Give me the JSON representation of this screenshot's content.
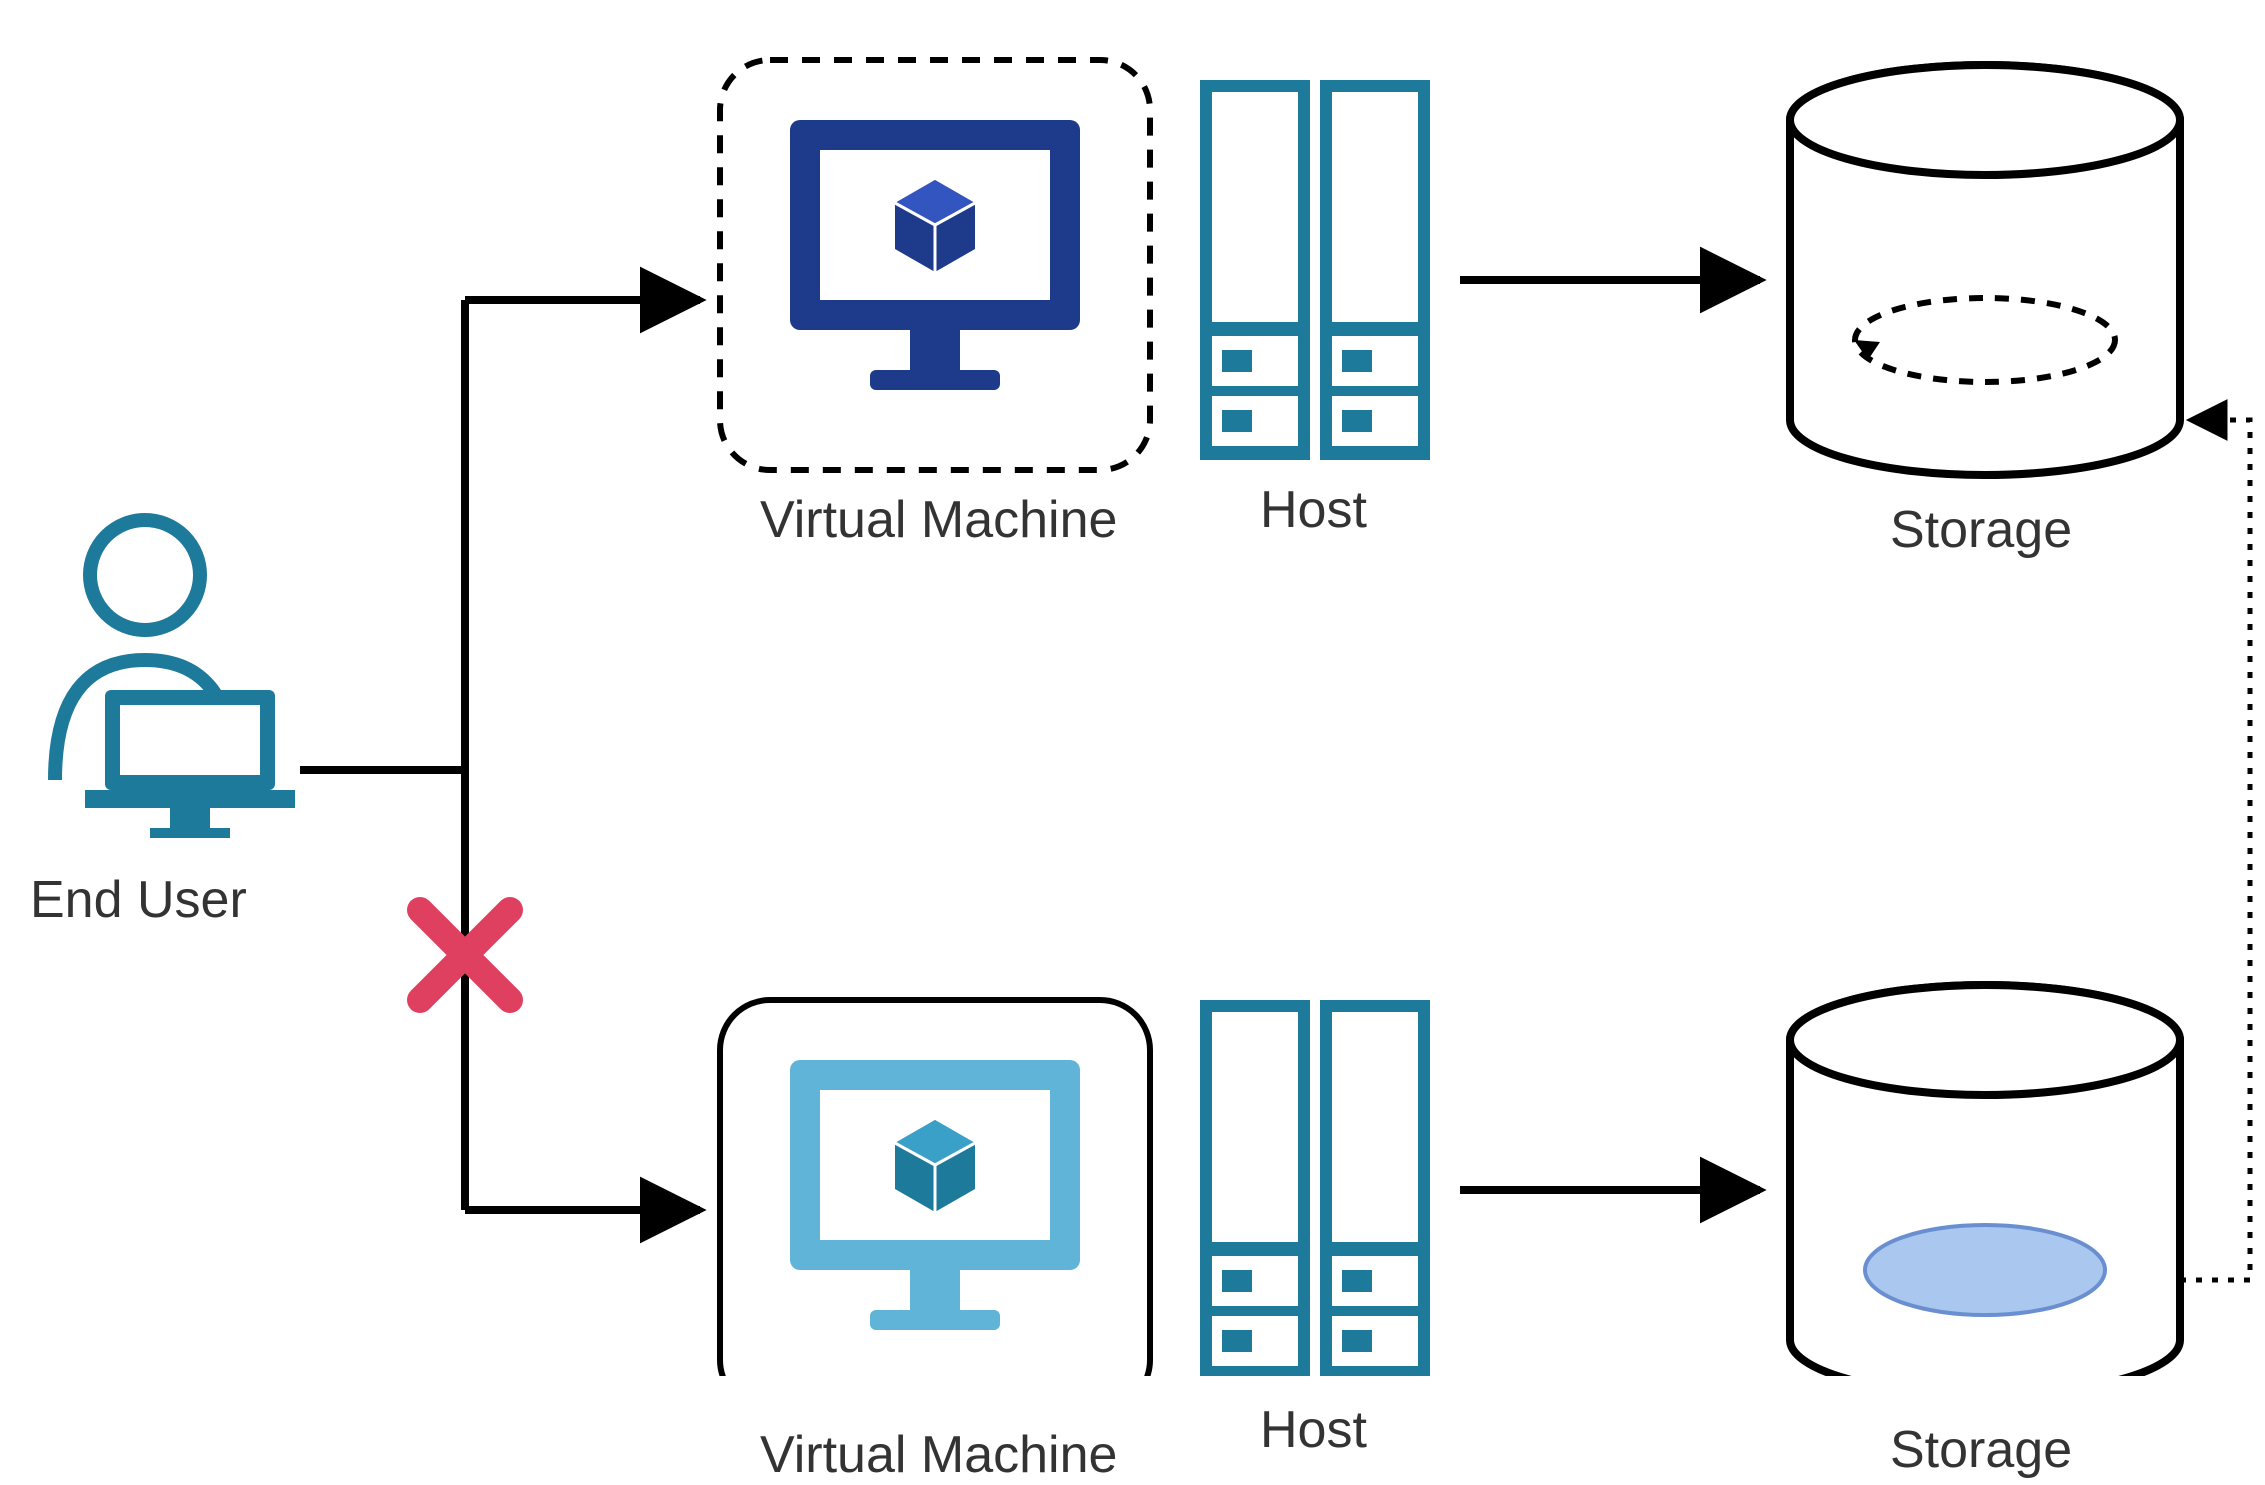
{
  "nodes": {
    "endUser": {
      "label": "End User"
    },
    "vmTop": {
      "label": "Virtual Machine",
      "style": "dashed"
    },
    "vmBottom": {
      "label": "Virtual Machine",
      "style": "solid"
    },
    "hostTop": {
      "label": "Host"
    },
    "hostBottom": {
      "label": "Host"
    },
    "storageTop": {
      "label": "Storage",
      "state": "empty-dashed-ellipse"
    },
    "storageBottom": {
      "label": "Storage",
      "state": "filled-ellipse"
    }
  },
  "edges": [
    {
      "from": "endUser",
      "to": "vmTop",
      "style": "solid-arrow"
    },
    {
      "from": "endUser",
      "to": "vmBottom",
      "style": "solid-arrow",
      "marker": "red-x"
    },
    {
      "from": "vmTop",
      "to": "hostTop",
      "style": "adjacent"
    },
    {
      "from": "vmBottom",
      "to": "hostBottom",
      "style": "adjacent"
    },
    {
      "from": "hostTop",
      "to": "storageTop",
      "style": "solid-arrow"
    },
    {
      "from": "hostBottom",
      "to": "storageBottom",
      "style": "solid-arrow"
    },
    {
      "from": "storageBottom",
      "to": "storageTop",
      "style": "dotted-arrow"
    }
  ],
  "colors": {
    "teal": "#1e7a9a",
    "navy": "#1e3a8a",
    "skyblue": "#5fb4d8",
    "red": "#e04060",
    "ink": "#222"
  }
}
